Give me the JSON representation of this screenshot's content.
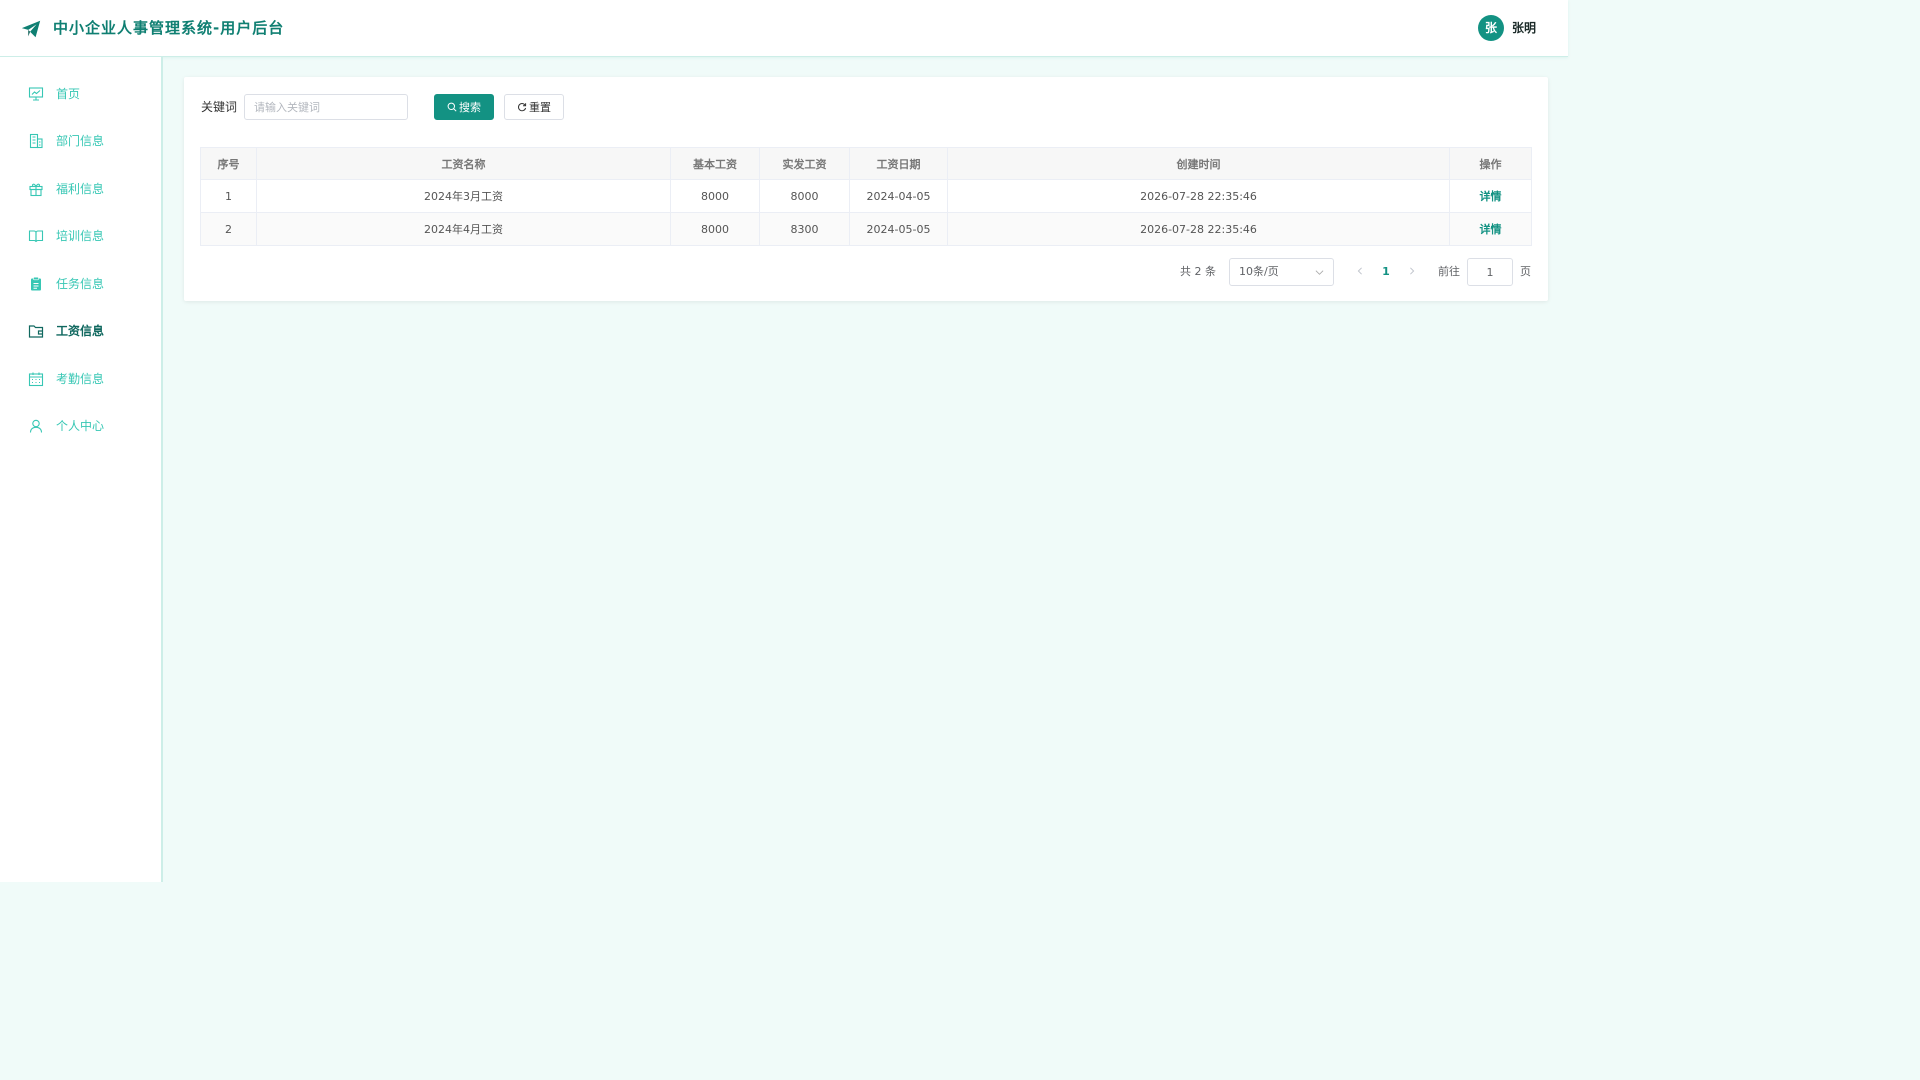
{
  "header": {
    "title": "中小企业人事管理系统-用户后台",
    "avatar_text": "张",
    "username": "张明",
    "accent_color": "#139283"
  },
  "sidebar": {
    "items": [
      {
        "label": "首页",
        "icon": "chart-icon",
        "active": false
      },
      {
        "label": "部门信息",
        "icon": "building-icon",
        "active": false
      },
      {
        "label": "福利信息",
        "icon": "gift-icon",
        "active": false
      },
      {
        "label": "培训信息",
        "icon": "book-icon",
        "active": false
      },
      {
        "label": "任务信息",
        "icon": "clipboard-icon",
        "active": false
      },
      {
        "label": "工资信息",
        "icon": "wallet-icon",
        "active": true
      },
      {
        "label": "考勤信息",
        "icon": "calendar-icon",
        "active": false
      },
      {
        "label": "个人中心",
        "icon": "user-icon",
        "active": false
      }
    ]
  },
  "search": {
    "label": "关键词",
    "placeholder": "请输入关键词",
    "value": "",
    "search_label": "搜索",
    "reset_label": "重置"
  },
  "table": {
    "columns": [
      "序号",
      "工资名称",
      "基本工资",
      "实发工资",
      "工资日期",
      "创建时间",
      "操作"
    ],
    "rows": [
      {
        "index": "1",
        "name": "2024年3月工资",
        "base": "8000",
        "actual": "8000",
        "date": "2024-04-05",
        "created": "2026-07-28 22:35:46",
        "action": "详情"
      },
      {
        "index": "2",
        "name": "2024年4月工资",
        "base": "8000",
        "actual": "8300",
        "date": "2024-05-05",
        "created": "2026-07-28 22:35:46",
        "action": "详情"
      }
    ]
  },
  "pagination": {
    "total_text": "共 2 条",
    "page_size": "10条/页",
    "current_page": "1",
    "goto_label": "前往",
    "goto_value": "1",
    "page_suffix": "页"
  }
}
